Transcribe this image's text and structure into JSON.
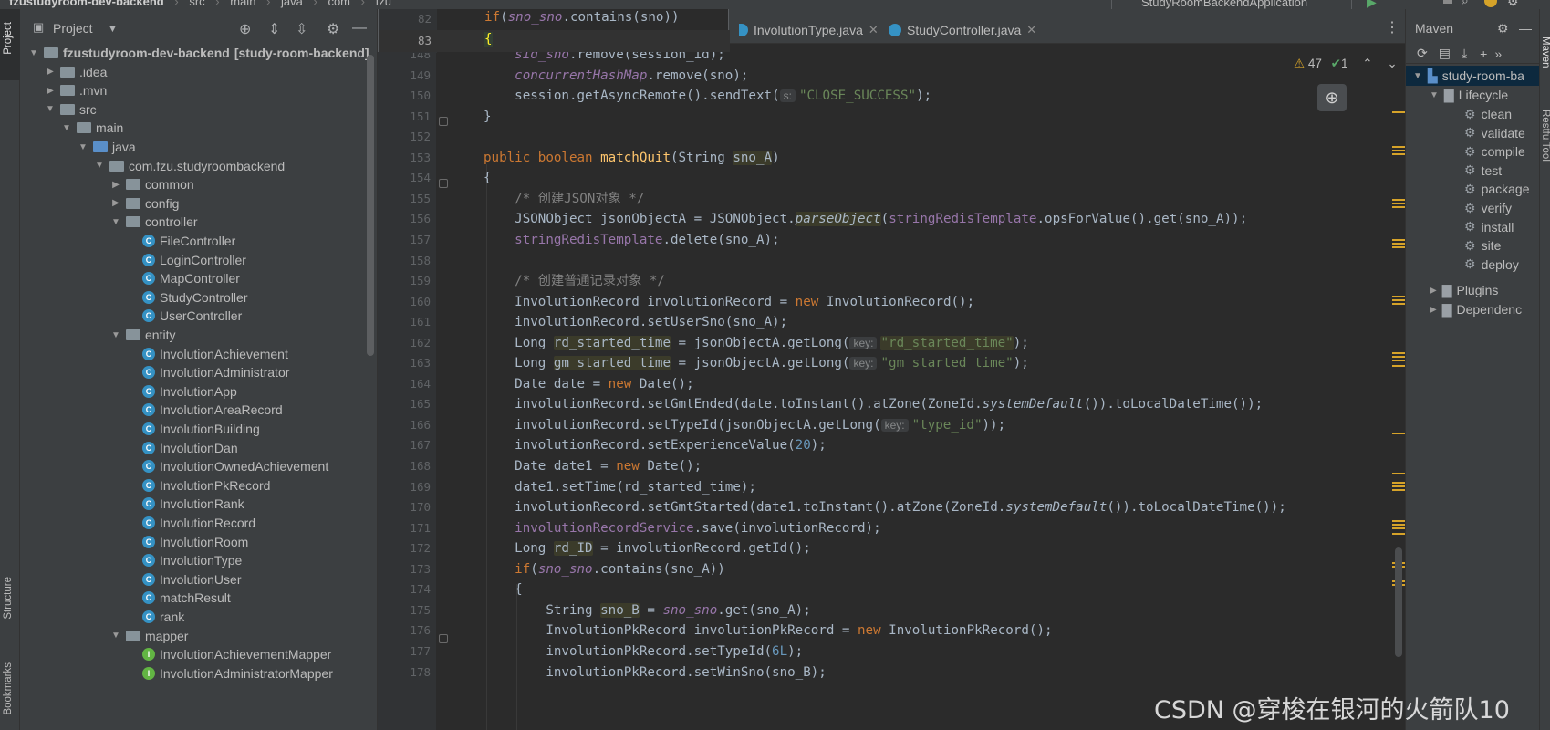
{
  "breadcrumb": {
    "project": "fzustudyroom-dev-backend",
    "parts": [
      "src",
      "main",
      "java",
      "com",
      "fzu"
    ]
  },
  "run_config": "StudyRoomBackendApplication",
  "left_strip": [
    "Project",
    "Structure",
    "Bookmarks"
  ],
  "project_panel": {
    "title": "Project",
    "tree": [
      {
        "label": "fzustudyroom-dev-backend",
        "suffix": "[study-room-backend]",
        "depth": 0,
        "kind": "module",
        "open": true
      },
      {
        "label": ".idea",
        "depth": 1,
        "kind": "folder",
        "open": false
      },
      {
        "label": ".mvn",
        "depth": 1,
        "kind": "folder",
        "open": false
      },
      {
        "label": "src",
        "depth": 1,
        "kind": "folder",
        "open": true
      },
      {
        "label": "main",
        "depth": 2,
        "kind": "folder",
        "open": true
      },
      {
        "label": "java",
        "depth": 3,
        "kind": "source",
        "open": true
      },
      {
        "label": "com.fzu.studyroombackend",
        "depth": 4,
        "kind": "package",
        "open": true
      },
      {
        "label": "common",
        "depth": 5,
        "kind": "package",
        "open": false
      },
      {
        "label": "config",
        "depth": 5,
        "kind": "package",
        "open": false
      },
      {
        "label": "controller",
        "depth": 5,
        "kind": "package",
        "open": true
      },
      {
        "label": "FileController",
        "depth": 6,
        "kind": "class"
      },
      {
        "label": "LoginController",
        "depth": 6,
        "kind": "class"
      },
      {
        "label": "MapController",
        "depth": 6,
        "kind": "class"
      },
      {
        "label": "StudyController",
        "depth": 6,
        "kind": "class"
      },
      {
        "label": "UserController",
        "depth": 6,
        "kind": "class"
      },
      {
        "label": "entity",
        "depth": 5,
        "kind": "package",
        "open": true
      },
      {
        "label": "InvolutionAchievement",
        "depth": 6,
        "kind": "class"
      },
      {
        "label": "InvolutionAdministrator",
        "depth": 6,
        "kind": "class"
      },
      {
        "label": "InvolutionApp",
        "depth": 6,
        "kind": "class"
      },
      {
        "label": "InvolutionAreaRecord",
        "depth": 6,
        "kind": "class"
      },
      {
        "label": "InvolutionBuilding",
        "depth": 6,
        "kind": "class"
      },
      {
        "label": "InvolutionDan",
        "depth": 6,
        "kind": "class"
      },
      {
        "label": "InvolutionOwnedAchievement",
        "depth": 6,
        "kind": "class"
      },
      {
        "label": "InvolutionPkRecord",
        "depth": 6,
        "kind": "class"
      },
      {
        "label": "InvolutionRank",
        "depth": 6,
        "kind": "class"
      },
      {
        "label": "InvolutionRecord",
        "depth": 6,
        "kind": "class"
      },
      {
        "label": "InvolutionRoom",
        "depth": 6,
        "kind": "class"
      },
      {
        "label": "InvolutionType",
        "depth": 6,
        "kind": "class"
      },
      {
        "label": "InvolutionUser",
        "depth": 6,
        "kind": "class"
      },
      {
        "label": "matchResult",
        "depth": 6,
        "kind": "class"
      },
      {
        "label": "rank",
        "depth": 6,
        "kind": "class"
      },
      {
        "label": "mapper",
        "depth": 5,
        "kind": "package",
        "open": true
      },
      {
        "label": "InvolutionAchievementMapper",
        "depth": 6,
        "kind": "interface"
      },
      {
        "label": "InvolutionAdministratorMapper",
        "depth": 6,
        "kind": "interface"
      }
    ]
  },
  "editor": {
    "tabs": [
      {
        "label": "InvolutionType.java"
      },
      {
        "label": "StudyController.java"
      }
    ],
    "popup_lines": [
      {
        "num": "82",
        "code": "if(sno_sno.contains(sno))"
      },
      {
        "num": "83",
        "code": "{"
      }
    ],
    "inspection": {
      "warnings": "47",
      "ok": "1"
    },
    "line_numbers": [
      "148",
      "149",
      "150",
      "151",
      "152",
      "153",
      "154",
      "155",
      "156",
      "157",
      "158",
      "159",
      "160",
      "161",
      "162",
      "163",
      "164",
      "165",
      "166",
      "167",
      "168",
      "169",
      "170",
      "171",
      "172",
      "173",
      "174",
      "175",
      "176",
      "177",
      "178"
    ]
  },
  "maven": {
    "title": "Maven",
    "project": "study-room-ba",
    "lifecycle": "Lifecycle",
    "goals": [
      "clean",
      "validate",
      "compile",
      "test",
      "package",
      "verify",
      "install",
      "site",
      "deploy"
    ],
    "plugins": "Plugins",
    "dependencies": "Dependenc"
  },
  "right_strip": [
    "Maven",
    "RestfulTool"
  ],
  "watermark": "CSDN @穿梭在银河的火箭队10"
}
